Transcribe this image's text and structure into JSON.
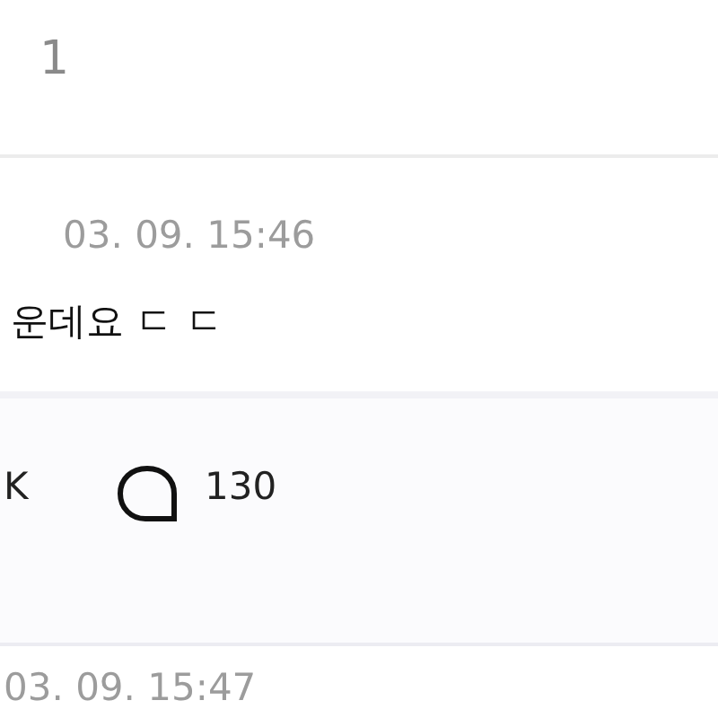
{
  "header": {
    "count": "1"
  },
  "comments": [
    {
      "time": "03. 09. 15:46",
      "body": "운데요 ㄷ ㄷ",
      "likes": "K",
      "replies": "130"
    },
    {
      "time": "03. 09. 15:47"
    }
  ]
}
